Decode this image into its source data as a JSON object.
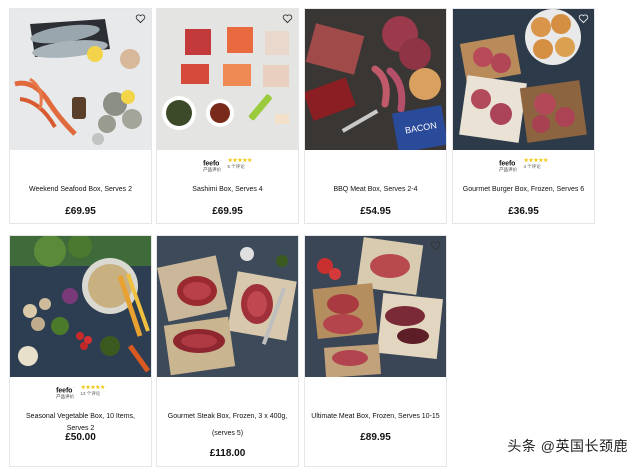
{
  "products": [
    {
      "name": "Weekend Seafood Box, Serves 2",
      "price": "£69.95",
      "feefo": null,
      "image": "seafood platter with fish, crab legs, oysters, lemon",
      "heart_icon": "heart-outline-icon"
    },
    {
      "name": "Sashimi Box, Serves 4",
      "price": "£69.95",
      "feefo": {
        "brand": "feefo",
        "sub": "产品评价",
        "stars": "★★★★★",
        "count": "5 个评论"
      },
      "image": "sashimi fish pieces, seaweed, soy sauce, wasabi",
      "heart_icon": "heart-outline-icon"
    },
    {
      "name": "BBQ Meat Box, Serves 2-4",
      "price": "£54.95",
      "feefo": null,
      "image": "ribs, burgers, sausages, bacon pack",
      "heart_icon": null
    },
    {
      "name": "Gourmet Burger Box, Frozen, Serves 6",
      "price": "£36.95",
      "feefo": {
        "brand": "feefo",
        "sub": "产品评价",
        "stars": "★★★★★",
        "count": "4 个评论"
      },
      "image": "burger patties, buns, herbs",
      "heart_icon": "heart-outline-icon"
    },
    {
      "name": "Seasonal Vegetable Box, 10 Items, Serves 2",
      "price": "£50.00",
      "feefo": {
        "brand": "feefo",
        "sub": "产品评价",
        "stars": "★★★★★",
        "count": "13 个评论"
      },
      "image": "assorted vegetables, mushrooms, tomatoes, carrots",
      "heart_icon": null
    },
    {
      "name": "Gourmet Steak Box, Frozen, 3 x 400g, (serves 5)",
      "price": "£118.00",
      "feefo": null,
      "image": "raw steaks on paper, herbs, carving fork",
      "heart_icon": null
    },
    {
      "name": "Ultimate Meat Box, Frozen, Serves 10-15",
      "price": "£89.95",
      "feefo": null,
      "image": "assorted raw meat cuts on boards",
      "heart_icon": "heart-outline-icon"
    }
  ],
  "watermark": "头条 @英国长颈鹿"
}
